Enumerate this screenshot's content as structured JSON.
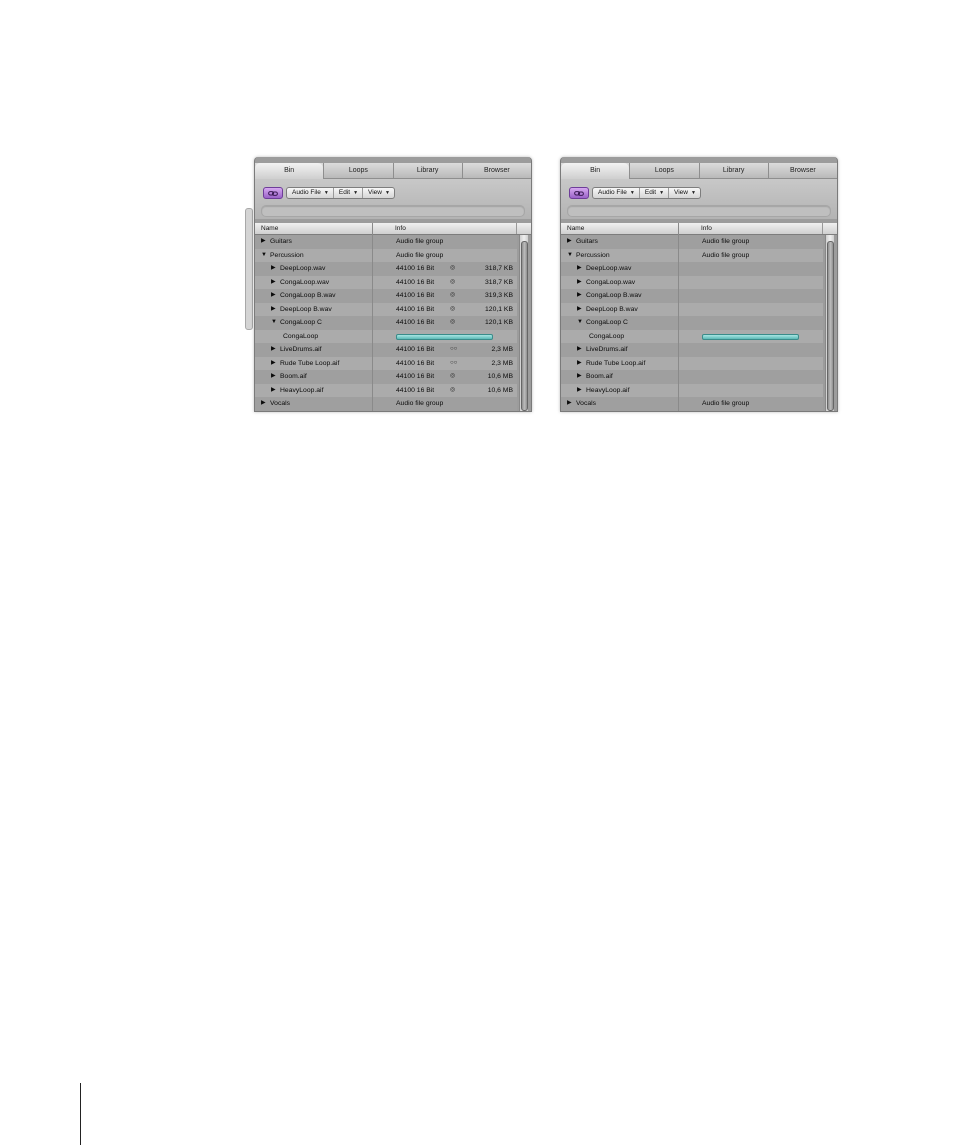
{
  "panels": [
    {
      "tabs": [
        "Bin",
        "Loops",
        "Library",
        "Browser"
      ],
      "active_tab": 0,
      "toolbar": {
        "menus": [
          "Audio File",
          "Edit",
          "View"
        ]
      },
      "columns": {
        "name": "Name",
        "info": "Info"
      },
      "rows": [
        {
          "indent": 0,
          "expanded": false,
          "name": "Guitars",
          "info": "Audio file group",
          "channels": "",
          "size": "",
          "waveform": false
        },
        {
          "indent": 0,
          "expanded": true,
          "name": "Percussion",
          "info": "Audio file group",
          "channels": "",
          "size": "",
          "waveform": false
        },
        {
          "indent": 1,
          "expanded": false,
          "name": "DeepLoop.wav",
          "info": "44100 16 Bit",
          "channels": "stereo",
          "size": "318,7 KB",
          "waveform": false
        },
        {
          "indent": 1,
          "expanded": false,
          "name": "CongaLoop.wav",
          "info": "44100 16 Bit",
          "channels": "stereo",
          "size": "318,7 KB",
          "waveform": false
        },
        {
          "indent": 1,
          "expanded": false,
          "name": "CongaLoop B.wav",
          "info": "44100 16 Bit",
          "channels": "stereo",
          "size": "319,3 KB",
          "waveform": false
        },
        {
          "indent": 1,
          "expanded": false,
          "name": "DeepLoop B.wav",
          "info": "44100 16 Bit",
          "channels": "stereo",
          "size": "120,1 KB",
          "waveform": false
        },
        {
          "indent": 1,
          "expanded": true,
          "name": "CongaLoop C",
          "info": "44100 16 Bit",
          "channels": "stereo",
          "size": "120,1 KB",
          "waveform": false
        },
        {
          "indent": 2,
          "expanded": null,
          "name": "CongaLoop",
          "info": "",
          "channels": "",
          "size": "",
          "waveform": true
        },
        {
          "indent": 1,
          "expanded": false,
          "name": "LiveDrums.aif",
          "info": "44100 16 Bit",
          "channels": "split-stereo",
          "size": "2,3 MB",
          "waveform": false
        },
        {
          "indent": 1,
          "expanded": false,
          "name": "Rude Tube Loop.aif",
          "info": "44100 16 Bit",
          "channels": "split-stereo",
          "size": "2,3 MB",
          "waveform": false
        },
        {
          "indent": 1,
          "expanded": false,
          "name": "Boom.aif",
          "info": "44100 16 Bit",
          "channels": "stereo",
          "size": "10,6 MB",
          "waveform": false
        },
        {
          "indent": 1,
          "expanded": false,
          "name": "HeavyLoop.aif",
          "info": "44100 16 Bit",
          "channels": "stereo",
          "size": "10,6 MB",
          "waveform": false
        },
        {
          "indent": 0,
          "expanded": false,
          "name": "Vocals",
          "info": "Audio file group",
          "channels": "",
          "size": "",
          "waveform": false
        }
      ]
    },
    {
      "tabs": [
        "Bin",
        "Loops",
        "Library",
        "Browser"
      ],
      "active_tab": 0,
      "toolbar": {
        "menus": [
          "Audio File",
          "Edit",
          "View"
        ]
      },
      "columns": {
        "name": "Name",
        "info": "Info"
      },
      "rows": [
        {
          "indent": 0,
          "expanded": false,
          "name": "Guitars",
          "info": "Audio file group",
          "channels": "",
          "size": "",
          "waveform": false
        },
        {
          "indent": 0,
          "expanded": true,
          "name": "Percussion",
          "info": "Audio file group",
          "channels": "",
          "size": "",
          "waveform": false
        },
        {
          "indent": 1,
          "expanded": false,
          "name": "DeepLoop.wav",
          "info": "",
          "channels": "",
          "size": "",
          "waveform": false
        },
        {
          "indent": 1,
          "expanded": false,
          "name": "CongaLoop.wav",
          "info": "",
          "channels": "",
          "size": "",
          "waveform": false
        },
        {
          "indent": 1,
          "expanded": false,
          "name": "CongaLoop B.wav",
          "info": "",
          "channels": "",
          "size": "",
          "waveform": false
        },
        {
          "indent": 1,
          "expanded": false,
          "name": "DeepLoop B.wav",
          "info": "",
          "channels": "",
          "size": "",
          "waveform": false
        },
        {
          "indent": 1,
          "expanded": true,
          "name": "CongaLoop C",
          "info": "",
          "channels": "",
          "size": "",
          "waveform": false
        },
        {
          "indent": 2,
          "expanded": null,
          "name": "CongaLoop",
          "info": "",
          "channels": "",
          "size": "",
          "waveform": true
        },
        {
          "indent": 1,
          "expanded": false,
          "name": "LiveDrums.aif",
          "info": "",
          "channels": "",
          "size": "",
          "waveform": false
        },
        {
          "indent": 1,
          "expanded": false,
          "name": "Rude Tube Loop.aif",
          "info": "",
          "channels": "",
          "size": "",
          "waveform": false
        },
        {
          "indent": 1,
          "expanded": false,
          "name": "Boom.aif",
          "info": "",
          "channels": "",
          "size": "",
          "waveform": false
        },
        {
          "indent": 1,
          "expanded": false,
          "name": "HeavyLoop.aif",
          "info": "",
          "channels": "",
          "size": "",
          "waveform": false
        },
        {
          "indent": 0,
          "expanded": false,
          "name": "Vocals",
          "info": "Audio file group",
          "channels": "",
          "size": "",
          "waveform": false
        }
      ]
    }
  ],
  "colors": {
    "accent_link": "#a46fd2",
    "waveform": "#6cc4c0"
  }
}
